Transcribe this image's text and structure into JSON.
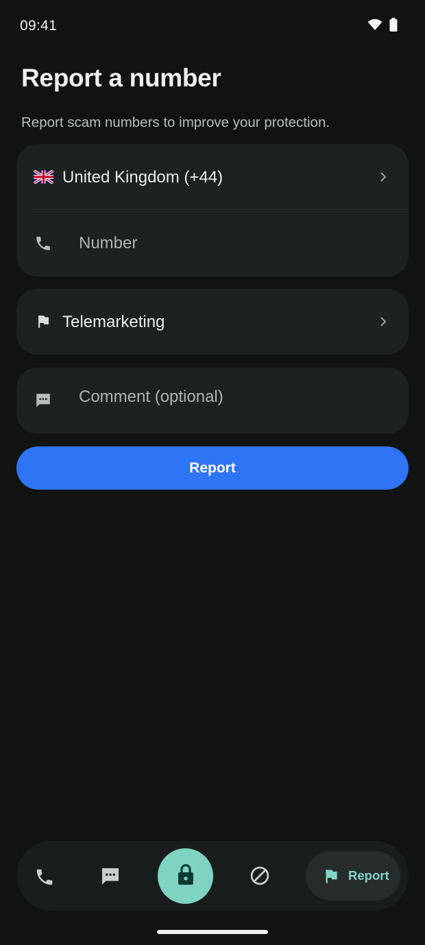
{
  "status_bar": {
    "time": "09:41"
  },
  "header": {
    "title": "Report a number",
    "subtitle": "Report scam numbers to improve your protection."
  },
  "form": {
    "country": {
      "flag": "🇬🇧",
      "label": "United Kingdom (+44)"
    },
    "number": {
      "placeholder": "Number",
      "icon": "phone-icon"
    },
    "category": {
      "label": "Telemarketing",
      "icon": "flag-icon"
    },
    "comment": {
      "placeholder": "Comment (optional)",
      "icon": "message-icon"
    },
    "submit_label": "Report"
  },
  "bottom_nav": {
    "items": [
      {
        "name": "calls",
        "icon": "phone-icon"
      },
      {
        "name": "messages",
        "icon": "message-icon"
      },
      {
        "name": "protection",
        "icon": "lock-icon"
      },
      {
        "name": "blocked",
        "icon": "block-icon"
      },
      {
        "name": "report",
        "icon": "flag-icon",
        "label": "Report",
        "active": true
      }
    ]
  },
  "colors": {
    "background": "#111313",
    "card": "#1d2121",
    "primary_button": "#2f74f5",
    "accent": "#7fd3c3"
  }
}
